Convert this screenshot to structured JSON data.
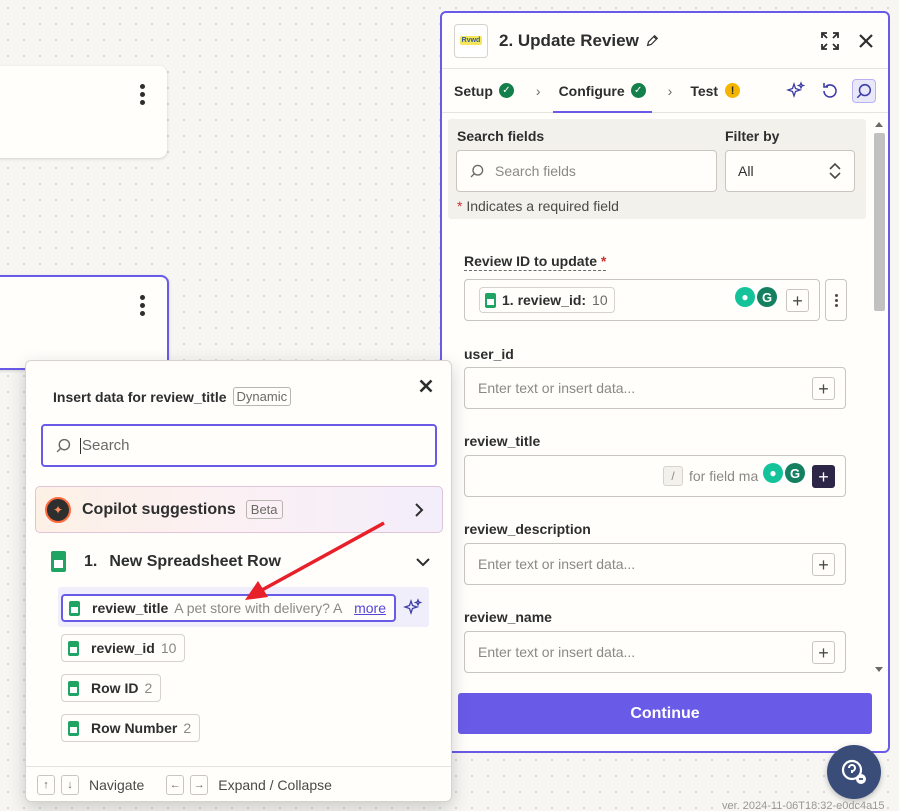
{
  "panel": {
    "title": "2. Update Review",
    "logo_text": "Rvwd",
    "tabs": [
      {
        "label": "Setup",
        "status": "complete"
      },
      {
        "label": "Configure",
        "status": "complete"
      },
      {
        "label": "Test",
        "status": "warning"
      }
    ],
    "search_fields": {
      "label": "Search fields",
      "placeholder": "Search fields",
      "filter_label": "Filter by",
      "filter_value": "All"
    },
    "required_note": "Indicates a required field",
    "fields": {
      "review_id": {
        "label": "Review ID to update",
        "chip_label": "1. review_id:",
        "chip_value": "10"
      },
      "user_id": {
        "label": "user_id",
        "placeholder": "Enter text or insert data..."
      },
      "review_title": {
        "label": "review_title",
        "slash_hint": "for field ma",
        "slash_key": "/"
      },
      "review_description": {
        "label": "review_description",
        "placeholder": "Enter text or insert data..."
      },
      "review_name": {
        "label": "review_name",
        "placeholder": "Enter text or insert data..."
      }
    },
    "continue_label": "Continue"
  },
  "dropdown": {
    "title": "Insert data for review_title",
    "badge": "Dynamic",
    "search_placeholder": "Search",
    "copilot": {
      "label": "Copilot suggestions",
      "badge": "Beta"
    },
    "group": {
      "number": "1.",
      "label": "New Spreadsheet Row"
    },
    "options": [
      {
        "key": "review_title",
        "value": "A pet store with delivery? A",
        "more": "more"
      },
      {
        "key": "review_id",
        "value": "10"
      },
      {
        "key": "Row ID",
        "value": "2"
      },
      {
        "key": "Row Number",
        "value": "2"
      }
    ],
    "footer": {
      "navigate": "Navigate",
      "expand": "Expand / Collapse"
    }
  },
  "version": "ver. 2024-11-06T18:32-e0dc4a15",
  "colors": {
    "accent": "#695be8",
    "success": "#13804b",
    "warning": "#f4b400",
    "annotation_arrow": "#e8202a"
  },
  "icons": [
    "edit-icon",
    "expand-icon",
    "close-icon",
    "check-icon",
    "warning-icon",
    "chevron-right-icon",
    "sparkle-icon",
    "history-icon",
    "search-icon",
    "sheets-icon",
    "grammarly-icon",
    "help-icon"
  ]
}
